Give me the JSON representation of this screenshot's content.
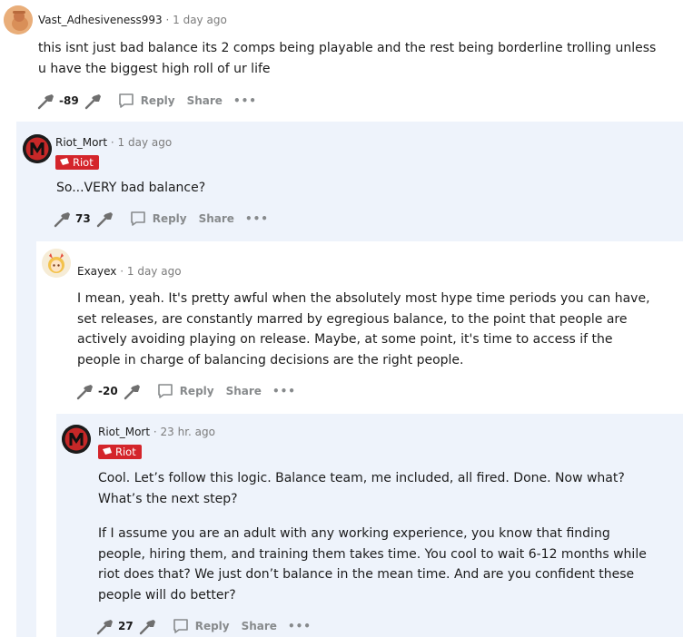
{
  "comments": [
    {
      "author": "Vast_Adhesiveness993",
      "time": "1 day ago",
      "body": [
        "this isnt just bad balance its 2 comps being playable and the rest being borderline trolling unless u have the biggest high roll of ur life"
      ],
      "score": "-89",
      "reply_label": "Reply",
      "share_label": "Share",
      "more_label": "•••"
    },
    {
      "author": "Riot_Mort",
      "time": "1 day ago",
      "flair": "Riot",
      "body": [
        "So...VERY bad balance?"
      ],
      "score": "73",
      "reply_label": "Reply",
      "share_label": "Share",
      "more_label": "•••"
    },
    {
      "author": "Exayex",
      "time": "1 day ago",
      "body": [
        "I mean, yeah. It's pretty awful when the absolutely most hype time periods you can have, set releases, are constantly marred by egregious balance, to the point that people are actively avoiding playing on release. Maybe, at some point, it's time to access if the people in charge of balancing decisions are the right people."
      ],
      "score": "-20",
      "reply_label": "Reply",
      "share_label": "Share",
      "more_label": "•••"
    },
    {
      "author": "Riot_Mort",
      "time": "23 hr. ago",
      "flair": "Riot",
      "body": [
        "Cool. Let’s follow this logic. Balance team, me included, all fired. Done. Now what? What’s the next step?",
        "If I assume you are an adult with any working experience, you know that finding people, hiring them, and training them takes time. You cool to wait 6-12 months while riot does that? We just don’t balance in the mean time. And are you confident these people will do better?"
      ],
      "score": "27",
      "reply_label": "Reply",
      "share_label": "Share",
      "more_label": "•••"
    }
  ],
  "colors": {
    "flair_bg": "#d4252b",
    "nested_bg": "#eef3fb",
    "muted_text": "#7c7c7c"
  }
}
